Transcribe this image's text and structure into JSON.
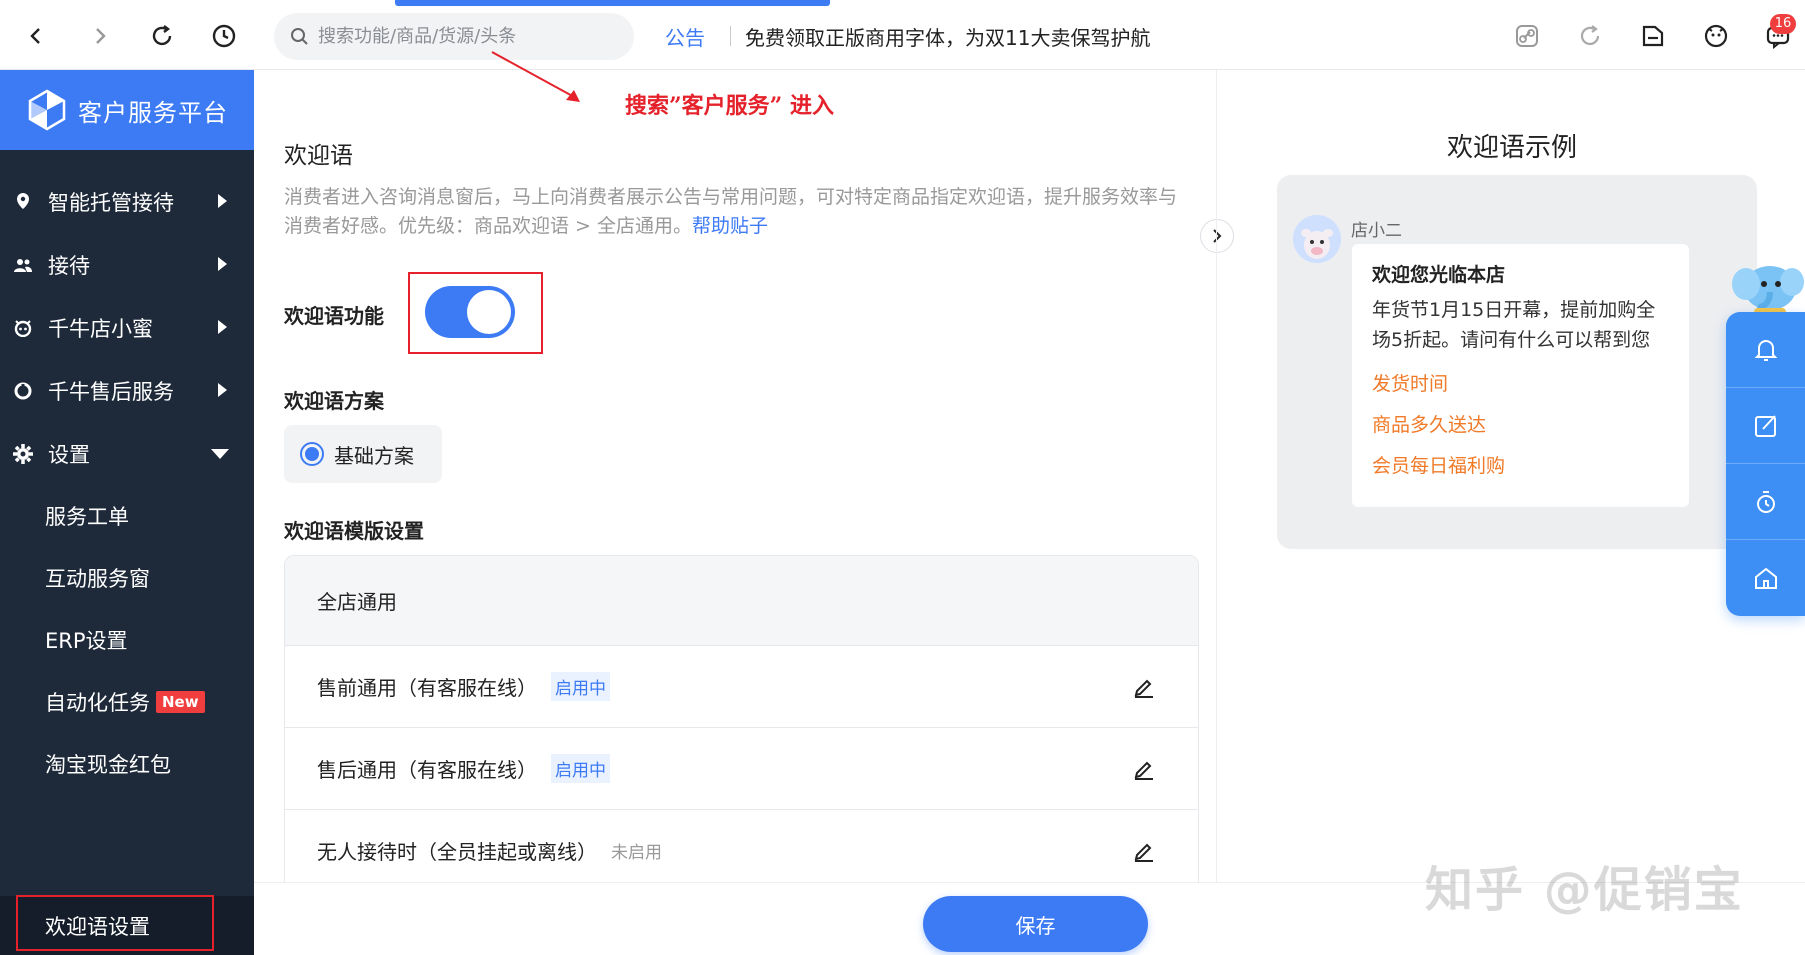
{
  "topbar": {
    "search_placeholder": "搜索功能/商品/货源/头条",
    "notice_label": "公告",
    "notice_text": "免费领取正版商用字体，为双11大卖保驾护航",
    "message_count": "16"
  },
  "annotation": "搜索”客户服务” 进入",
  "sidebar": {
    "brand": "客户服务平台",
    "items": [
      {
        "label": "智能托管接待"
      },
      {
        "label": "接待"
      },
      {
        "label": "千牛店小蜜"
      },
      {
        "label": "千牛售后服务"
      },
      {
        "label": "设置"
      }
    ],
    "sub_items": [
      {
        "label": "服务工单"
      },
      {
        "label": "互动服务窗"
      },
      {
        "label": "ERP设置"
      },
      {
        "label": "自动化任务",
        "badge": "New"
      },
      {
        "label": "淘宝现金红包"
      },
      {
        "label": "欢迎语设置"
      }
    ]
  },
  "main": {
    "section_title": "欢迎语",
    "description": "消费者进入咨询消息窗后，马上向消费者展示公告与常用问题，可对特定商品指定欢迎语，提升服务效率与消费者好感。优先级：商品欢迎语 > 全店通用。",
    "help_link": "帮助贴子",
    "feature_label": "欢迎语功能",
    "feature_enabled": true,
    "plan_label": "欢迎语方案",
    "plan_option": "基础方案",
    "template_label": "欢迎语模版设置",
    "template_header": "全店通用",
    "templates": [
      {
        "name": "售前通用（有客服在线）",
        "status": "启用中",
        "active": true
      },
      {
        "name": "售后通用（有客服在线）",
        "status": "启用中",
        "active": true
      },
      {
        "name": "无人接待时（全员挂起或离线）",
        "status": "未启用",
        "active": false
      }
    ],
    "save_label": "保存"
  },
  "preview": {
    "title": "欢迎语示例",
    "shop_name": "店小二",
    "bubble_title": "欢迎您光临本店",
    "bubble_text": "年货节1月15日开幕，提前加购全场5折起。请问有什么可以帮到您",
    "links": [
      "发货时间",
      "商品多久送达",
      "会员每日福利购"
    ]
  },
  "watermark": "知乎 @促销宝",
  "colors": {
    "accent": "#3d7bf5",
    "sidebar": "#1e2a3a",
    "link_orange": "#f07a28",
    "highlight_red": "#e5222b"
  }
}
